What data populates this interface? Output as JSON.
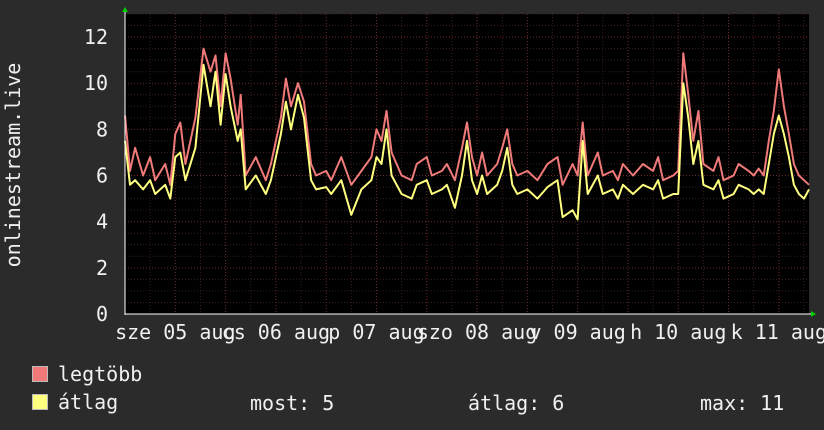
{
  "chart_data": {
    "type": "line",
    "ylabel": "onlinestream.live",
    "ylim": [
      0,
      13
    ],
    "yticks": [
      0,
      2,
      4,
      6,
      8,
      10,
      12
    ],
    "grid": true,
    "xlim": [
      0,
      6.8
    ],
    "xticks": [
      {
        "x": 0.5,
        "label": "sze 05 aug"
      },
      {
        "x": 1.5,
        "label": "cs 06 aug"
      },
      {
        "x": 2.5,
        "label": "p 07 aug"
      },
      {
        "x": 3.5,
        "label": "szo 08 aug"
      },
      {
        "x": 4.5,
        "label": "v 09 aug"
      },
      {
        "x": 5.5,
        "label": "h 10 aug"
      },
      {
        "x": 6.5,
        "label": "k 11 aug"
      }
    ],
    "series": [
      {
        "name": "legtöbb",
        "color": "#f07a7a",
        "points": [
          [
            0,
            8.6
          ],
          [
            0.05,
            6.2
          ],
          [
            0.1,
            7.2
          ],
          [
            0.18,
            6.0
          ],
          [
            0.25,
            6.8
          ],
          [
            0.3,
            5.8
          ],
          [
            0.4,
            6.5
          ],
          [
            0.45,
            5.6
          ],
          [
            0.5,
            7.8
          ],
          [
            0.55,
            8.3
          ],
          [
            0.6,
            6.5
          ],
          [
            0.7,
            8.5
          ],
          [
            0.78,
            11.5
          ],
          [
            0.85,
            10.5
          ],
          [
            0.9,
            11.2
          ],
          [
            0.95,
            9.0
          ],
          [
            1.0,
            11.3
          ],
          [
            1.05,
            10.2
          ],
          [
            1.12,
            8.2
          ],
          [
            1.15,
            9.5
          ],
          [
            1.2,
            6.0
          ],
          [
            1.3,
            6.8
          ],
          [
            1.4,
            5.8
          ],
          [
            1.45,
            6.5
          ],
          [
            1.55,
            8.5
          ],
          [
            1.6,
            10.2
          ],
          [
            1.65,
            9.0
          ],
          [
            1.72,
            10.0
          ],
          [
            1.78,
            9.2
          ],
          [
            1.85,
            6.5
          ],
          [
            1.9,
            6.0
          ],
          [
            2.0,
            6.2
          ],
          [
            2.05,
            5.8
          ],
          [
            2.15,
            6.8
          ],
          [
            2.25,
            5.6
          ],
          [
            2.35,
            6.2
          ],
          [
            2.45,
            6.8
          ],
          [
            2.5,
            8.0
          ],
          [
            2.55,
            7.5
          ],
          [
            2.6,
            8.8
          ],
          [
            2.65,
            7.0
          ],
          [
            2.75,
            6.0
          ],
          [
            2.85,
            5.8
          ],
          [
            2.9,
            6.5
          ],
          [
            3.0,
            6.8
          ],
          [
            3.05,
            6.0
          ],
          [
            3.15,
            6.2
          ],
          [
            3.2,
            6.5
          ],
          [
            3.28,
            5.8
          ],
          [
            3.35,
            7.2
          ],
          [
            3.4,
            8.3
          ],
          [
            3.45,
            6.8
          ],
          [
            3.5,
            6.0
          ],
          [
            3.55,
            7.0
          ],
          [
            3.6,
            6.0
          ],
          [
            3.7,
            6.5
          ],
          [
            3.75,
            7.2
          ],
          [
            3.8,
            8.0
          ],
          [
            3.85,
            6.5
          ],
          [
            3.9,
            6.0
          ],
          [
            4.0,
            6.2
          ],
          [
            4.1,
            5.8
          ],
          [
            4.2,
            6.5
          ],
          [
            4.3,
            6.8
          ],
          [
            4.35,
            5.6
          ],
          [
            4.45,
            6.5
          ],
          [
            4.5,
            6.0
          ],
          [
            4.55,
            8.3
          ],
          [
            4.6,
            6.0
          ],
          [
            4.7,
            7.0
          ],
          [
            4.75,
            6.0
          ],
          [
            4.85,
            6.2
          ],
          [
            4.9,
            5.8
          ],
          [
            4.95,
            6.5
          ],
          [
            5.05,
            6.0
          ],
          [
            5.15,
            6.5
          ],
          [
            5.25,
            6.2
          ],
          [
            5.3,
            6.8
          ],
          [
            5.35,
            5.8
          ],
          [
            5.45,
            6.0
          ],
          [
            5.5,
            6.2
          ],
          [
            5.55,
            11.3
          ],
          [
            5.6,
            9.5
          ],
          [
            5.65,
            7.5
          ],
          [
            5.7,
            8.8
          ],
          [
            5.75,
            6.5
          ],
          [
            5.85,
            6.2
          ],
          [
            5.9,
            6.8
          ],
          [
            5.95,
            5.8
          ],
          [
            6.05,
            6.0
          ],
          [
            6.1,
            6.5
          ],
          [
            6.2,
            6.2
          ],
          [
            6.25,
            6.0
          ],
          [
            6.3,
            6.3
          ],
          [
            6.35,
            6.0
          ],
          [
            6.4,
            7.5
          ],
          [
            6.45,
            8.8
          ],
          [
            6.5,
            10.6
          ],
          [
            6.55,
            9.0
          ],
          [
            6.6,
            7.8
          ],
          [
            6.65,
            6.5
          ],
          [
            6.7,
            6.0
          ],
          [
            6.75,
            5.8
          ],
          [
            6.8,
            5.6
          ]
        ]
      },
      {
        "name": "átlag",
        "color": "#ffff80",
        "points": [
          [
            0,
            7.5
          ],
          [
            0.05,
            5.6
          ],
          [
            0.1,
            5.8
          ],
          [
            0.18,
            5.4
          ],
          [
            0.25,
            5.8
          ],
          [
            0.3,
            5.2
          ],
          [
            0.4,
            5.6
          ],
          [
            0.45,
            5.0
          ],
          [
            0.5,
            6.8
          ],
          [
            0.55,
            7.0
          ],
          [
            0.6,
            5.8
          ],
          [
            0.7,
            7.2
          ],
          [
            0.78,
            10.8
          ],
          [
            0.85,
            9.0
          ],
          [
            0.9,
            10.5
          ],
          [
            0.95,
            8.2
          ],
          [
            1.0,
            10.4
          ],
          [
            1.05,
            9.0
          ],
          [
            1.12,
            7.5
          ],
          [
            1.15,
            8.0
          ],
          [
            1.2,
            5.4
          ],
          [
            1.3,
            6.0
          ],
          [
            1.4,
            5.2
          ],
          [
            1.45,
            5.8
          ],
          [
            1.55,
            7.8
          ],
          [
            1.6,
            9.2
          ],
          [
            1.65,
            8.0
          ],
          [
            1.72,
            9.5
          ],
          [
            1.78,
            8.5
          ],
          [
            1.85,
            5.8
          ],
          [
            1.9,
            5.4
          ],
          [
            2.0,
            5.5
          ],
          [
            2.05,
            5.2
          ],
          [
            2.15,
            5.8
          ],
          [
            2.25,
            4.3
          ],
          [
            2.35,
            5.4
          ],
          [
            2.45,
            5.8
          ],
          [
            2.5,
            6.8
          ],
          [
            2.55,
            6.5
          ],
          [
            2.6,
            8.0
          ],
          [
            2.65,
            6.0
          ],
          [
            2.75,
            5.2
          ],
          [
            2.85,
            5.0
          ],
          [
            2.9,
            5.6
          ],
          [
            3.0,
            5.8
          ],
          [
            3.05,
            5.2
          ],
          [
            3.15,
            5.4
          ],
          [
            3.2,
            5.6
          ],
          [
            3.28,
            4.6
          ],
          [
            3.35,
            6.0
          ],
          [
            3.4,
            7.5
          ],
          [
            3.45,
            5.8
          ],
          [
            3.5,
            5.2
          ],
          [
            3.55,
            6.0
          ],
          [
            3.6,
            5.2
          ],
          [
            3.7,
            5.6
          ],
          [
            3.75,
            6.2
          ],
          [
            3.8,
            7.2
          ],
          [
            3.85,
            5.6
          ],
          [
            3.9,
            5.2
          ],
          [
            4.0,
            5.4
          ],
          [
            4.1,
            5.0
          ],
          [
            4.2,
            5.5
          ],
          [
            4.3,
            5.8
          ],
          [
            4.35,
            4.2
          ],
          [
            4.45,
            4.5
          ],
          [
            4.5,
            4.1
          ],
          [
            4.55,
            7.5
          ],
          [
            4.6,
            5.2
          ],
          [
            4.7,
            6.0
          ],
          [
            4.75,
            5.2
          ],
          [
            4.85,
            5.4
          ],
          [
            4.9,
            5.0
          ],
          [
            4.95,
            5.6
          ],
          [
            5.05,
            5.2
          ],
          [
            5.15,
            5.6
          ],
          [
            5.25,
            5.4
          ],
          [
            5.3,
            5.8
          ],
          [
            5.35,
            5.0
          ],
          [
            5.45,
            5.2
          ],
          [
            5.5,
            5.2
          ],
          [
            5.55,
            10.0
          ],
          [
            5.6,
            8.5
          ],
          [
            5.65,
            6.5
          ],
          [
            5.7,
            7.5
          ],
          [
            5.75,
            5.6
          ],
          [
            5.85,
            5.4
          ],
          [
            5.9,
            5.8
          ],
          [
            5.95,
            5.0
          ],
          [
            6.05,
            5.2
          ],
          [
            6.1,
            5.6
          ],
          [
            6.2,
            5.4
          ],
          [
            6.25,
            5.2
          ],
          [
            6.3,
            5.4
          ],
          [
            6.35,
            5.2
          ],
          [
            6.4,
            6.5
          ],
          [
            6.45,
            7.8
          ],
          [
            6.5,
            8.6
          ],
          [
            6.55,
            7.8
          ],
          [
            6.6,
            6.8
          ],
          [
            6.65,
            5.6
          ],
          [
            6.7,
            5.2
          ],
          [
            6.75,
            5.0
          ],
          [
            6.8,
            5.4
          ]
        ]
      }
    ]
  },
  "legend": [
    {
      "label": "legtöbb",
      "color": "#f07a7a"
    },
    {
      "label": "átlag",
      "color": "#ffff80"
    }
  ],
  "stats": {
    "most_label": "most:",
    "most_value": "5",
    "atlag_label": "átlag:",
    "atlag_value": "6",
    "max_label": "max:",
    "max_value": "11"
  }
}
